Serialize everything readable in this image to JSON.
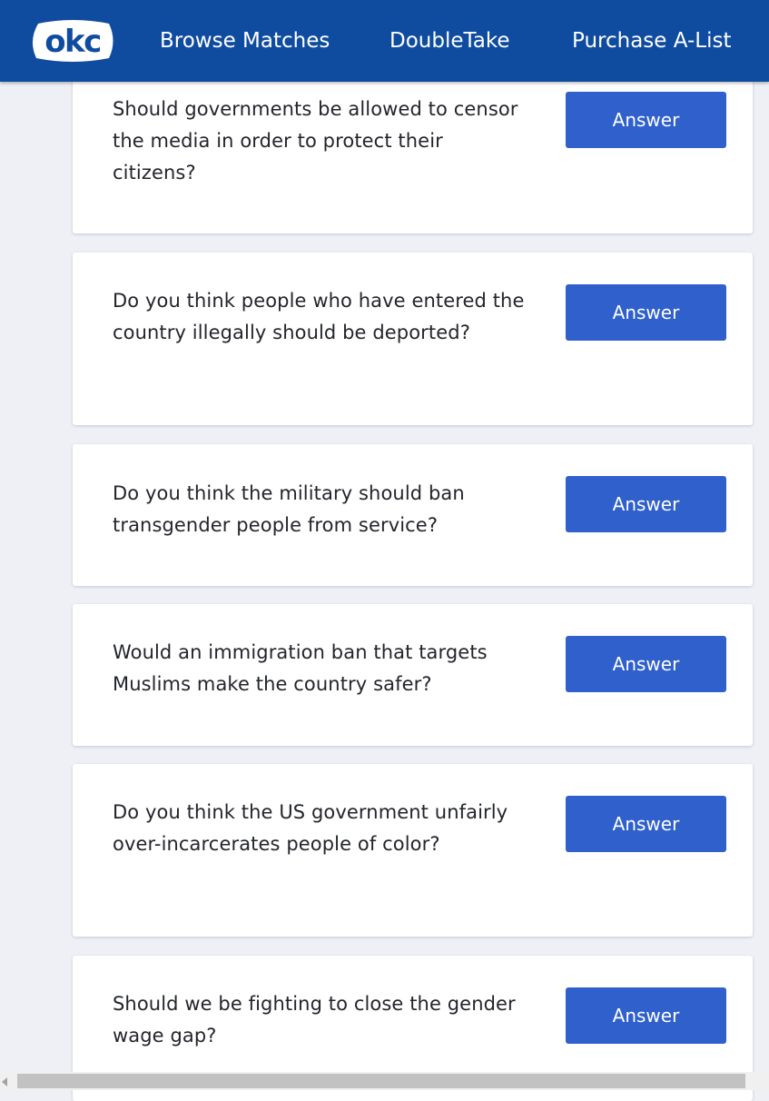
{
  "header": {
    "logo_text": "okc",
    "nav": [
      {
        "label": "Browse Matches"
      },
      {
        "label": "DoubleTake"
      },
      {
        "label": "Purchase A-List"
      }
    ]
  },
  "questions": [
    {
      "text": "Should governments be allowed to censor the media in order to protect their citizens?",
      "button": "Answer"
    },
    {
      "text": "Do you think people who have entered the country illegally should be deported?",
      "button": "Answer"
    },
    {
      "text": "Do you think the military should ban transgender people from service?",
      "button": "Answer"
    },
    {
      "text": "Would an immigration ban that targets Muslims make the country safer?",
      "button": "Answer"
    },
    {
      "text": "Do you think the US government unfairly over-incarcerates people of color?",
      "button": "Answer"
    },
    {
      "text": "Should we be fighting to close the gender wage gap?",
      "button": "Answer"
    }
  ],
  "colors": {
    "header_bg": "#0f4ca0",
    "button_bg": "#2f60cc",
    "page_bg": "#eef0f5"
  },
  "icons": {
    "logo": "okc-logo",
    "scroll_left": "scroll-left-arrow-icon"
  }
}
